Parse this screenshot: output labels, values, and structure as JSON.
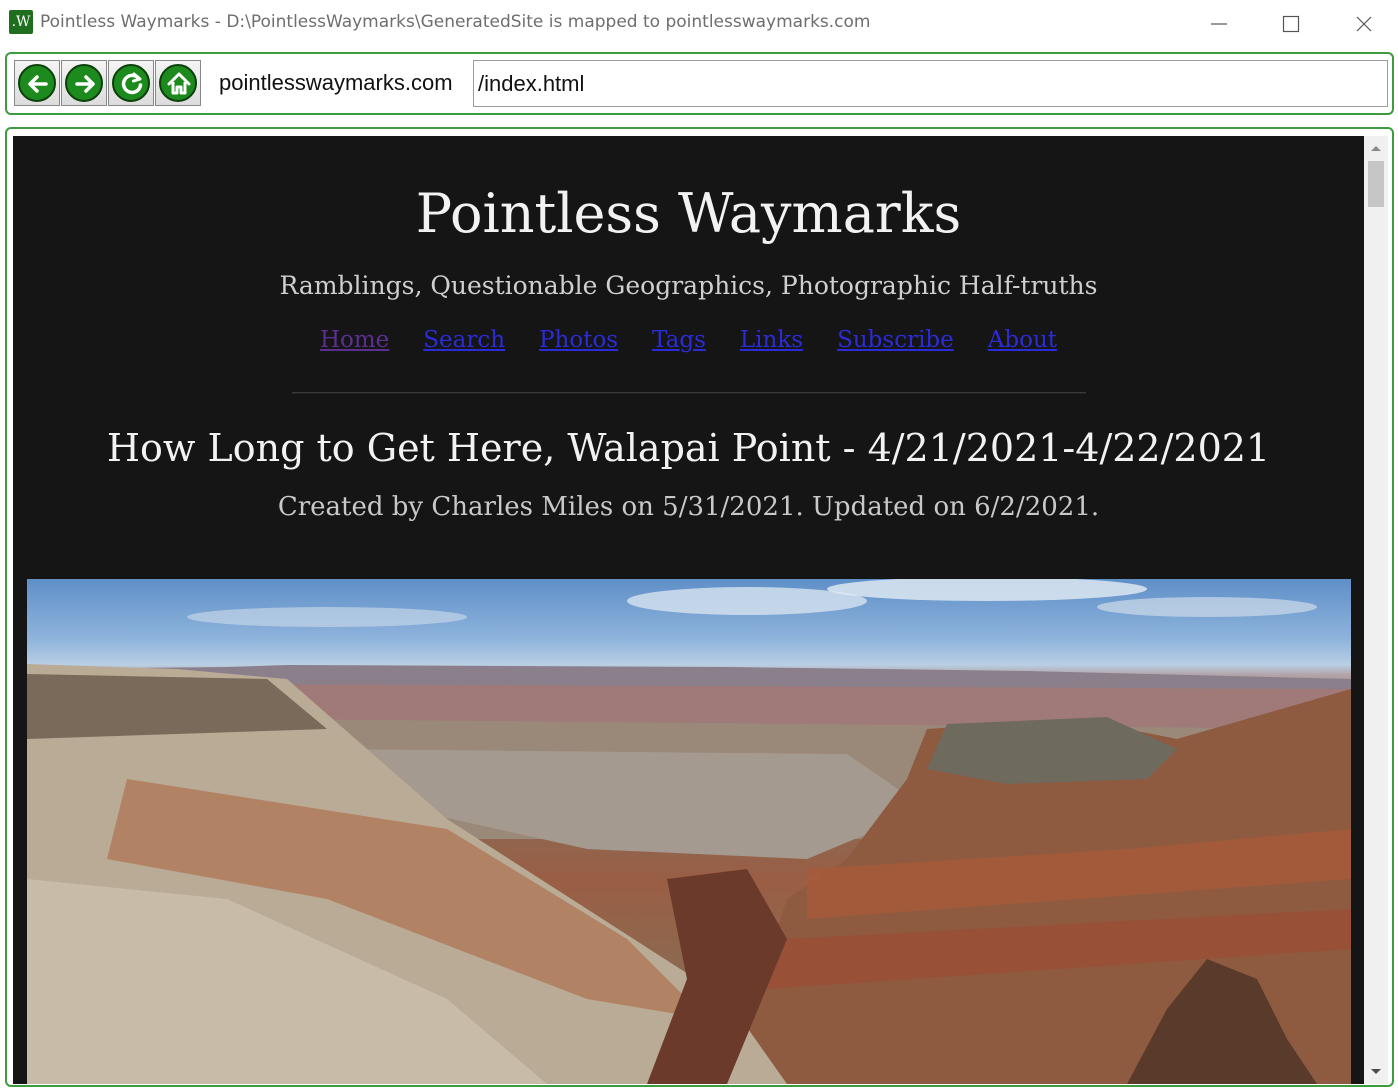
{
  "window": {
    "title": "Pointless Waymarks - D:\\PointlessWaymarks\\GeneratedSite is mapped to pointlesswaymarks.com",
    "app_icon_text": ".W"
  },
  "toolbar": {
    "buttons": [
      "back-icon",
      "forward-icon",
      "refresh-icon",
      "home-icon"
    ],
    "host": "pointlesswaymarks.com",
    "path": "/index.html",
    "accent": "#1c8a1c"
  },
  "site": {
    "title": "Pointless Waymarks",
    "tagline": "Ramblings, Questionable Geographics, Photographic Half-truths",
    "nav": [
      "Home",
      "Search",
      "Photos",
      "Tags",
      "Links",
      "Subscribe",
      "About"
    ],
    "background": "#151515",
    "link_color": "#2b2bd8",
    "visited_color": "#5a2f8f"
  },
  "post": {
    "title": "How Long to Get Here, Walapai Point - 4/21/2021-4/22/2021",
    "meta": "Created by Charles Miles on 5/31/2021. Updated on 6/2/2021."
  }
}
